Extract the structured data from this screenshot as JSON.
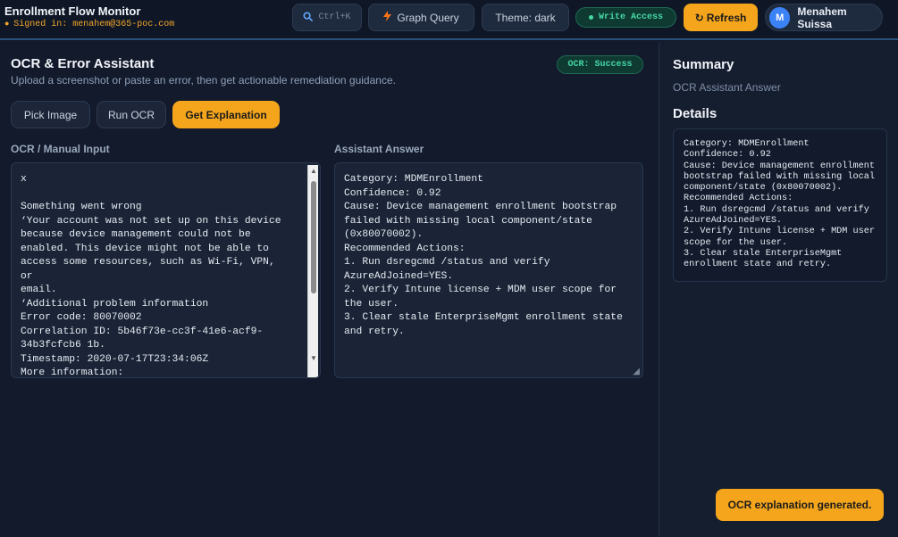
{
  "header": {
    "app_title": "Enrollment Flow Monitor",
    "signed_in": "Signed in: menahem@365-poc.com",
    "search_shortcut": "Ctrl+K",
    "graph_query": "Graph Query",
    "theme": "Theme: dark",
    "write_access": "Write Access",
    "refresh": "Refresh",
    "user_initial": "M",
    "user_name": "Menahem Suissa"
  },
  "main": {
    "title": "OCR & Error Assistant",
    "subtitle": "Upload a screenshot or paste an error, then get actionable remediation guidance.",
    "status_badge": "OCR: Success",
    "buttons": {
      "pick_image": "Pick Image",
      "run_ocr": "Run OCR",
      "get_explanation": "Get Explanation"
    },
    "input_label": "OCR / Manual Input",
    "input_value": "x\n\nSomething went wrong\n‘Your account was not set up on this device\nbecause device management could not be\nenabled. This device might not be able to\naccess some resources, such as Wi-Fi, VPN,\nor\nemail.\n‘Additional problem information\nError code: 80070002\nCorrelation ID: 5b46f73e-cc3f-41e6-acf9-\n34b3fcfcb6 1b.\nTimestamp: 2020-07-17T23:34:06Z\nMore information:",
    "answer_label": "Assistant Answer",
    "answer_value": "Category: MDMEnrollment\nConfidence: 0.92\nCause: Device management enrollment bootstrap\nfailed with missing local component/state\n(0x80070002).\nRecommended Actions:\n1. Run dsregcmd /status and verify\nAzureAdJoined=YES.\n2. Verify Intune license + MDM user scope for\nthe user.\n3. Clear stale EnterpriseMgmt enrollment state\nand retry."
  },
  "summary": {
    "title": "Summary",
    "subtitle": "OCR Assistant Answer",
    "details_title": "Details",
    "details_text": "Category: MDMEnrollment\nConfidence: 0.92\nCause: Device management enrollment\nbootstrap failed with missing local\ncomponent/state (0x80070002).\nRecommended Actions:\n1. Run dsregcmd /status and verify\nAzureAdJoined=YES.\n2. Verify Intune license + MDM user\nscope for the user.\n3. Clear stale EnterpriseMgmt\nenrollment state and retry."
  },
  "toast": "OCR explanation generated.",
  "colors": {
    "accent": "#f4a51c",
    "success": "#45d6a4",
    "background": "#121a2b"
  },
  "icons": [
    "search-icon",
    "lightning-icon",
    "refresh-icon",
    "status-dot-icon"
  ]
}
